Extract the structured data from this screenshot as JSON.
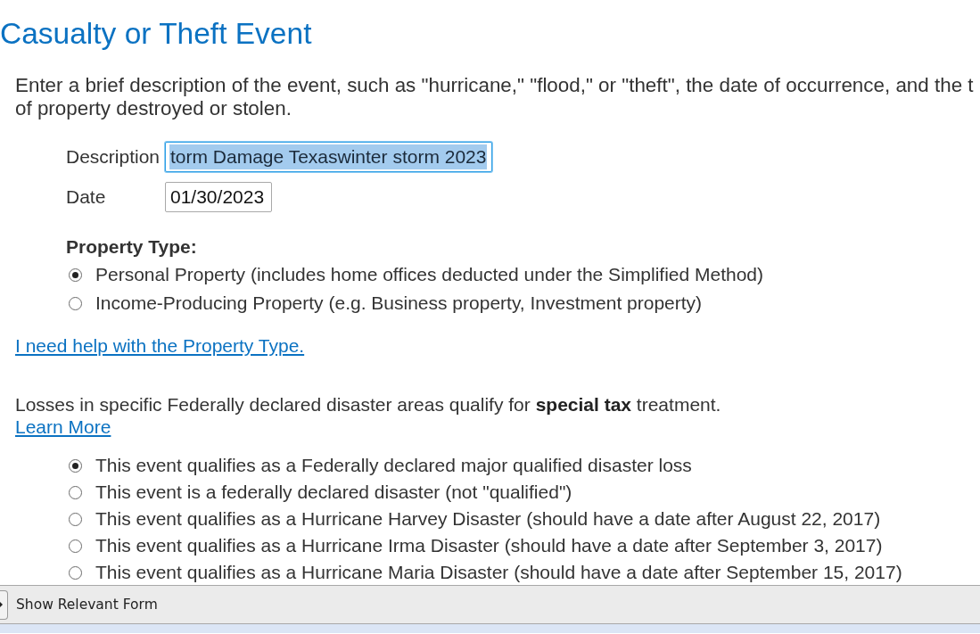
{
  "page_title": "Casualty or Theft Event",
  "intro": {
    "lines": [
      "Enter a brief description of the event, such as \"hurricane,\" \"flood,\" or \"theft\", the date of occurrence, and the t",
      "of property destroyed or stolen."
    ]
  },
  "fields": [
    {
      "kind": "text",
      "label": "Description",
      "value": "torm Damage Texaswinter storm 2023",
      "focused": true,
      "text_selected": true
    },
    {
      "kind": "date",
      "label": "Date",
      "value": "01/30/2023",
      "focused": false,
      "text_selected": false
    }
  ],
  "property_type": {
    "heading": "Property Type:",
    "options": [
      {
        "label": "Personal Property (includes home offices deducted under the Simplified Method)",
        "selected": true
      },
      {
        "label": "Income-Producing Property (e.g. Business property, Investment property)",
        "selected": false
      }
    ]
  },
  "help_link": "I need help with the Property Type.",
  "disaster_note": {
    "text": "Losses in specific Federally declared disaster areas qualify for **special tax** treatment.",
    "link": "Learn More"
  },
  "disaster_options": [
    {
      "label": "This event qualifies as a Federally declared major qualified disaster loss",
      "selected": true
    },
    {
      "label": "This event is a federally declared disaster (not \"qualified\")",
      "selected": false
    },
    {
      "label": "This event qualifies as a Hurricane Harvey Disaster (should have a date after August 22, 2017)",
      "selected": false
    },
    {
      "label": "This event qualifies as a Hurricane Irma Disaster (should have a date after September 3, 2017)",
      "selected": false
    },
    {
      "label": "This event qualifies as a Hurricane Maria Disaster (should have a date after September 15, 2017)",
      "selected": false
    }
  ],
  "footer": {
    "toggle_label": "Show Relevant Form"
  }
}
